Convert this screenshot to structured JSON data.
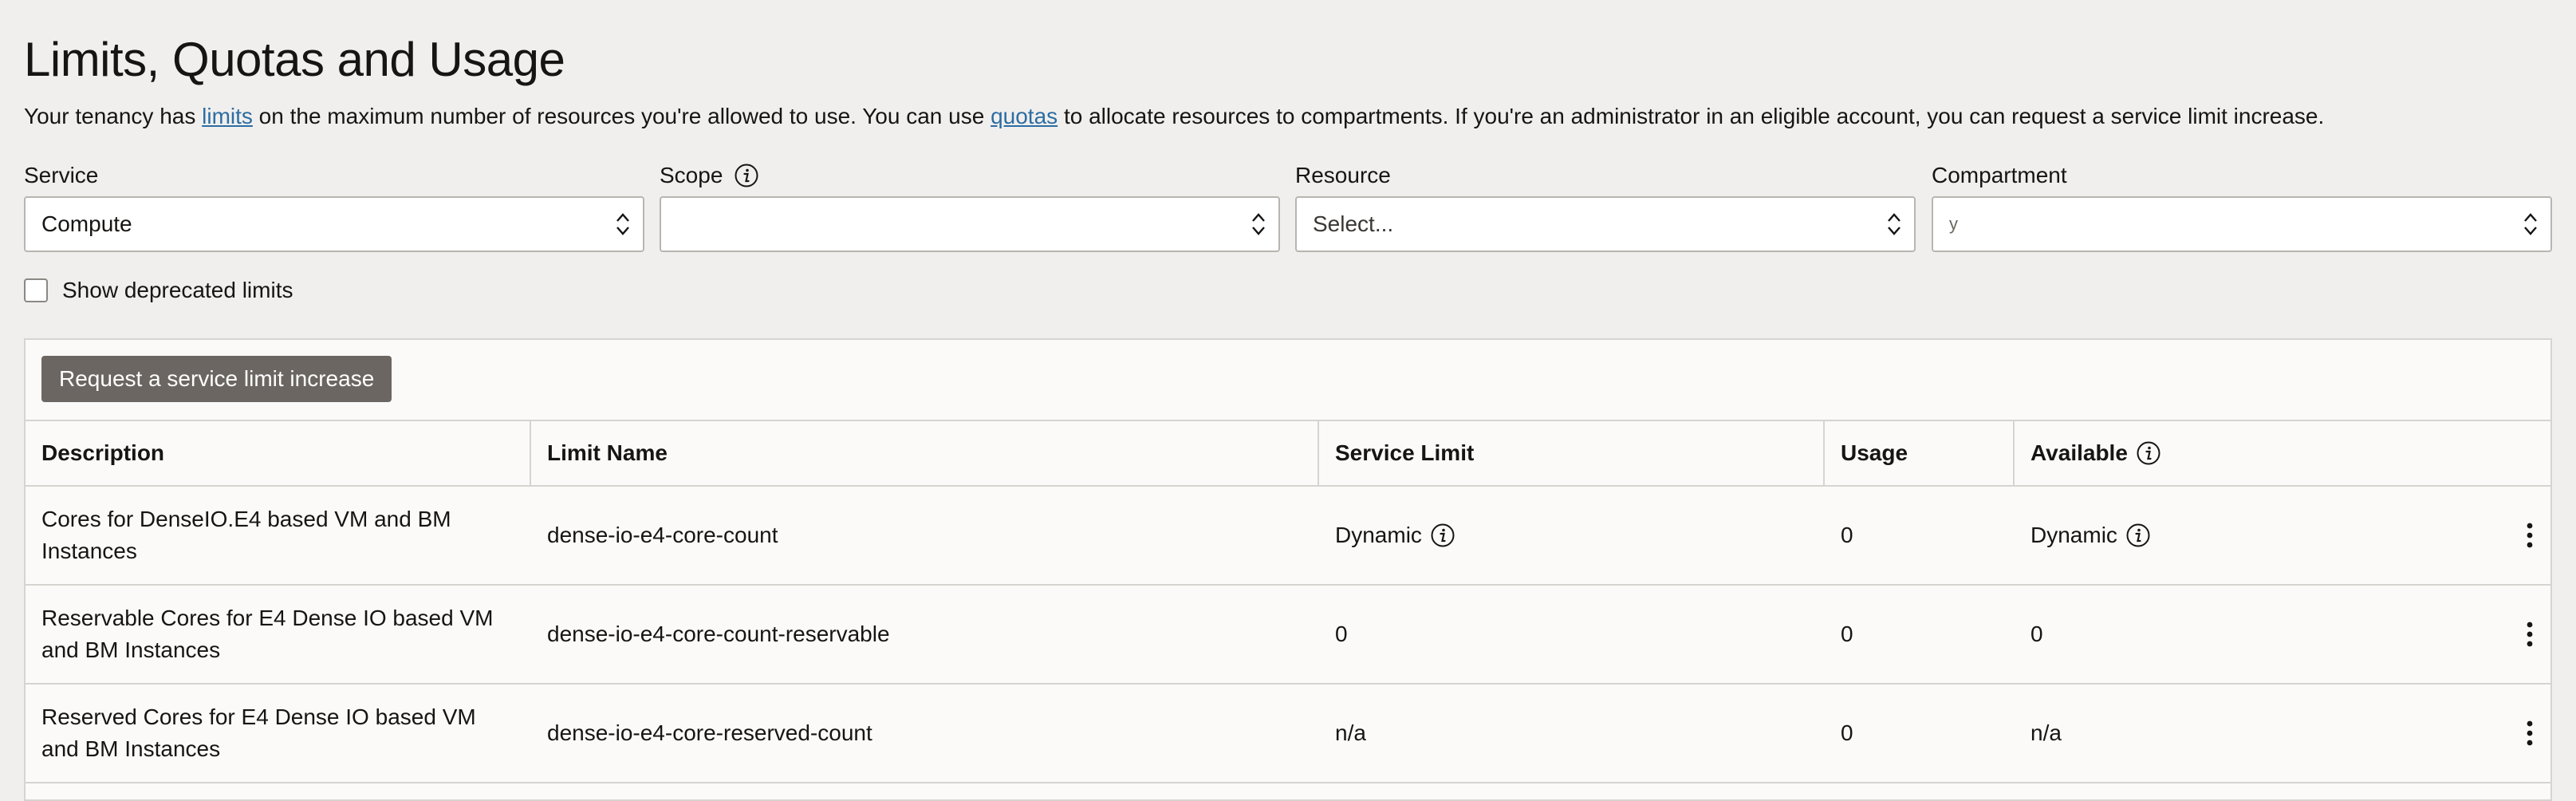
{
  "page": {
    "title": "Limits, Quotas and Usage",
    "description": {
      "part1": "Your tenancy has ",
      "link1": "limits",
      "part2": " on the maximum number of resources you're allowed to use. You can use ",
      "link2": "quotas",
      "part3": " to allocate resources to compartments. If you're an administrator in an eligible account, you can request a service limit increase."
    }
  },
  "filters": {
    "service": {
      "label": "Service",
      "value": "Compute"
    },
    "scope": {
      "label": "Scope",
      "value": ""
    },
    "resource": {
      "label": "Resource",
      "value": "Select..."
    },
    "compartment": {
      "label": "Compartment",
      "value": "y"
    }
  },
  "show_deprecated": {
    "label": "Show deprecated limits",
    "checked": false
  },
  "request_button": "Request a service limit increase",
  "table": {
    "headers": {
      "description": "Description",
      "limit_name": "Limit Name",
      "service_limit": "Service Limit",
      "usage": "Usage",
      "available": "Available"
    },
    "rows": [
      {
        "description": "Cores for DenseIO.E4 based VM and BM Instances",
        "limit_name": "dense-io-e4-core-count",
        "service_limit": "Dynamic",
        "usage": "0",
        "available": "Dynamic"
      },
      {
        "description": "Reservable Cores for E4 Dense IO based VM and BM Instances",
        "limit_name": "dense-io-e4-core-count-reservable",
        "service_limit": "0",
        "usage": "0",
        "available": "0"
      },
      {
        "description": "Reserved Cores for E4 Dense IO based VM and BM Instances",
        "limit_name": "dense-io-e4-core-reserved-count",
        "service_limit": "n/a",
        "usage": "0",
        "available": "n/a"
      }
    ]
  },
  "colors": {
    "background": "#f0efed",
    "link": "#2c6da3",
    "button": "#6b6661",
    "border": "#d7d4d0"
  }
}
